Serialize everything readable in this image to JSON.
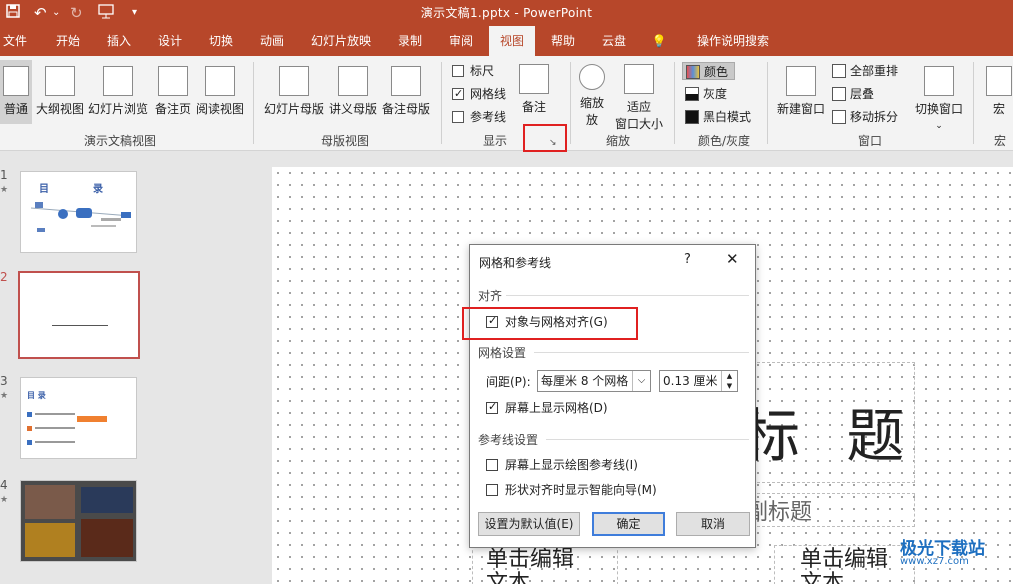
{
  "titlebar": {
    "title": "演示文稿1.pptx  -  PowerPoint",
    "quick_access": [
      "save-icon",
      "undo-icon",
      "redo-icon",
      "present-icon",
      "customize-icon"
    ],
    "undo_dropdown": "⌄"
  },
  "tabs": [
    "文件",
    "开始",
    "插入",
    "设计",
    "切换",
    "动画",
    "幻灯片放映",
    "录制",
    "审阅",
    "视图",
    "帮助",
    "云盘",
    "操作说明搜索"
  ],
  "active_tab": "视图",
  "ribbon": {
    "pres_views": [
      "普通",
      "大纲视图",
      "幻灯片浏览",
      "备注页",
      "阅读视图"
    ],
    "pres_views_label": "演示文稿视图",
    "master_views": [
      "幻灯片母版",
      "讲义母版",
      "备注母版"
    ],
    "master_views_label": "母版视图",
    "show": {
      "ruler": "标尺",
      "gridlines": "网格线",
      "guides": "参考线",
      "notes": "备注",
      "label": "显示"
    },
    "zoom": {
      "zoom": "缩放",
      "zoom2": "放",
      "fit": "适应",
      "fit2": "窗口大小",
      "label": "缩放"
    },
    "color": {
      "color": "颜色",
      "gray": "灰度",
      "bw": "黑白模式",
      "label": "颜色/灰度"
    },
    "window": {
      "new": "新建窗口",
      "arrange": "全部重排",
      "cascade": "层叠",
      "split": "移动拆分",
      "label": "窗口"
    },
    "switch": "切换窗口",
    "switch_arrow": "⌄",
    "macro": "宏",
    "macro_label": "宏",
    "launcher": "↘"
  },
  "thumbnails": {
    "numbers": [
      "1",
      "2",
      "3",
      "4"
    ],
    "star": "★",
    "slide1_title": "目",
    "slide1_title2": "录",
    "slide3_title": "目 录"
  },
  "slide": {
    "title_text": "标 题",
    "subtitle_text": "副标题",
    "body_left": "单击编辑",
    "body_left2": "文本",
    "body_right": "单击编辑",
    "body_right2": "文本"
  },
  "dialog": {
    "title": "网格和参考线",
    "help": "?",
    "close": "✕",
    "section_align": "对齐",
    "snap_label": "对象与网格对齐(G)",
    "snap_checked": true,
    "section_grid": "网格设置",
    "spacing_label": "间距(P):",
    "spacing_value": "每厘米 8 个网格",
    "spacing_cm": "0.13 厘米",
    "show_grid_label": "屏幕上显示网格(D)",
    "show_grid_checked": true,
    "section_guides": "参考线设置",
    "show_guides_label": "屏幕上显示绘图参考线(I)",
    "show_guides_checked": false,
    "smart_guides_label": "形状对齐时显示智能向导(M)",
    "smart_guides_checked": false,
    "btn_default": "设置为默认值(E)",
    "btn_ok": "确定",
    "btn_cancel": "取消"
  },
  "watermark": {
    "text": "极光下载站",
    "url": "www.xz7.com"
  },
  "colors": {
    "accent": "#b7472a",
    "highlight": "#e02020",
    "selected_slide": "#c0504d"
  }
}
